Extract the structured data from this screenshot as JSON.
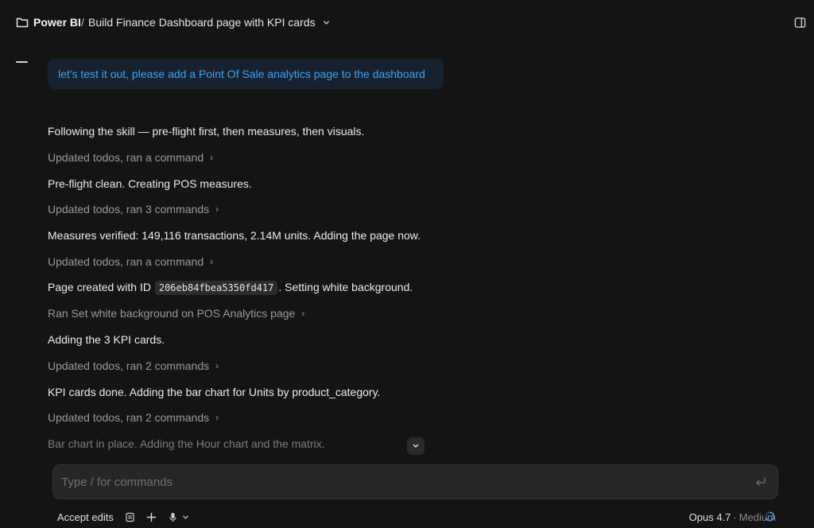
{
  "header": {
    "project": "Power BI",
    "separator": "/",
    "title": "Build Finance Dashboard page with KPI cards"
  },
  "conversation": {
    "user_message": "let's test it out, please add a Point Of Sale analytics page to the dashboard",
    "lines": [
      {
        "kind": "text",
        "text": "Following the skill — pre-flight first, then measures, then visuals."
      },
      {
        "kind": "tool",
        "text": "Updated todos, ran a command"
      },
      {
        "kind": "text",
        "text": "Pre-flight clean. Creating POS measures."
      },
      {
        "kind": "tool",
        "text": "Updated todos, ran 3 commands"
      },
      {
        "kind": "text",
        "text": "Measures verified: 149,116 transactions, 2.14M units. Adding the page now."
      },
      {
        "kind": "tool",
        "text": "Updated todos, ran a command"
      },
      {
        "kind": "text_code",
        "before": "Page created with ID",
        "code": "206eb84fbea5350fd417",
        "after": ". Setting white background."
      },
      {
        "kind": "tool",
        "text": "Ran Set white background on POS Analytics page"
      },
      {
        "kind": "text",
        "text": "Adding the 3 KPI cards."
      },
      {
        "kind": "tool",
        "text": "Updated todos, ran 2 commands"
      },
      {
        "kind": "text",
        "text": "KPI cards done. Adding the bar chart for Units by product_category."
      },
      {
        "kind": "tool",
        "text": "Updated todos, ran 2 commands"
      },
      {
        "kind": "fade",
        "text": "Bar chart in place. Adding the Hour chart and the matrix."
      }
    ]
  },
  "composer": {
    "placeholder": "Type / for commands"
  },
  "footer": {
    "mode": "Accept edits",
    "model": "Opus 4.7",
    "separator": "·",
    "effort": "Medium"
  },
  "icons": {
    "folder": "folder-icon",
    "breadcrumb_chevron": "chevron-down-icon",
    "panel": "sidebar-panel-icon",
    "scroll_down": "chevron-down-icon",
    "enter": "enter-icon",
    "attach": "document-icon",
    "add": "plus-icon",
    "mic": "microphone-icon",
    "mic_chevron": "chevron-down-icon",
    "status": "spinner-icon"
  },
  "colors": {
    "background": "#141414",
    "user_bubble": "#172230",
    "user_text": "#3aa3f2",
    "tool_text": "#9a9a9a",
    "spinner": "#3b8fe0"
  }
}
